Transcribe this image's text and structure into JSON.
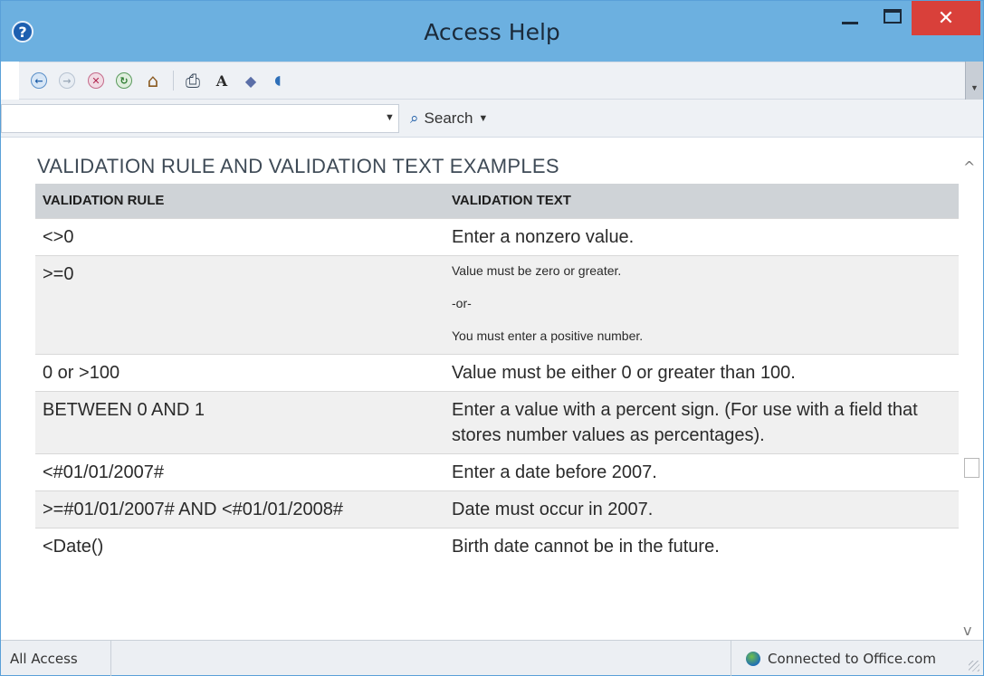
{
  "window": {
    "title": "Access Help"
  },
  "titlebar": {
    "help_glyph": "?",
    "close_glyph": "✕"
  },
  "toolbar": {
    "icons": [
      "back-icon",
      "forward-icon",
      "stop-icon",
      "refresh-icon",
      "home-icon",
      "print-icon",
      "text-size-icon",
      "book-icon",
      "pin-icon"
    ],
    "back_glyph": "←",
    "forward_glyph": "→",
    "stop_glyph": "✕",
    "refresh_glyph": "↻",
    "home_glyph": "⌂",
    "print_glyph": "⎙",
    "text_size_glyph": "A",
    "book_glyph": "◆",
    "pin_glyph": "◖"
  },
  "search": {
    "value": "",
    "placeholder": "",
    "dropdown_glyph": "▼",
    "button_label": "Search",
    "button_caret": "▼",
    "mag_glyph": "⌕"
  },
  "content": {
    "title": "VALIDATION RULE AND VALIDATION TEXT EXAMPLES",
    "columns": [
      "VALIDATION RULE",
      "VALIDATION TEXT"
    ],
    "rows": [
      {
        "rule": "<>0",
        "text": "Enter a nonzero value."
      },
      {
        "rule": ">=0",
        "text_lines": [
          "Value must be zero or greater.",
          "-or-",
          "You must enter a positive number."
        ]
      },
      {
        "rule": "0 or >100",
        "text": "Value must be either 0 or greater than 100."
      },
      {
        "rule": "BETWEEN 0 AND 1",
        "text": "Enter a value with a percent sign. (For use with a field that stores number values as percentages)."
      },
      {
        "rule": "<#01/01/2007#",
        "text": "Enter a date before 2007."
      },
      {
        "rule": ">=#01/01/2007# AND <#01/01/2008#",
        "text": "Date must occur in 2007."
      },
      {
        "rule": "<Date()",
        "text": "Birth date cannot be in the future."
      }
    ]
  },
  "scrollbar": {
    "up_glyph": "^",
    "down_glyph": "v"
  },
  "status": {
    "left": "All Access",
    "right": "Connected to Office.com"
  },
  "colors": {
    "titlebar": "#6cb0e0",
    "close": "#d9403a",
    "header_row": "#cfd3d7"
  }
}
